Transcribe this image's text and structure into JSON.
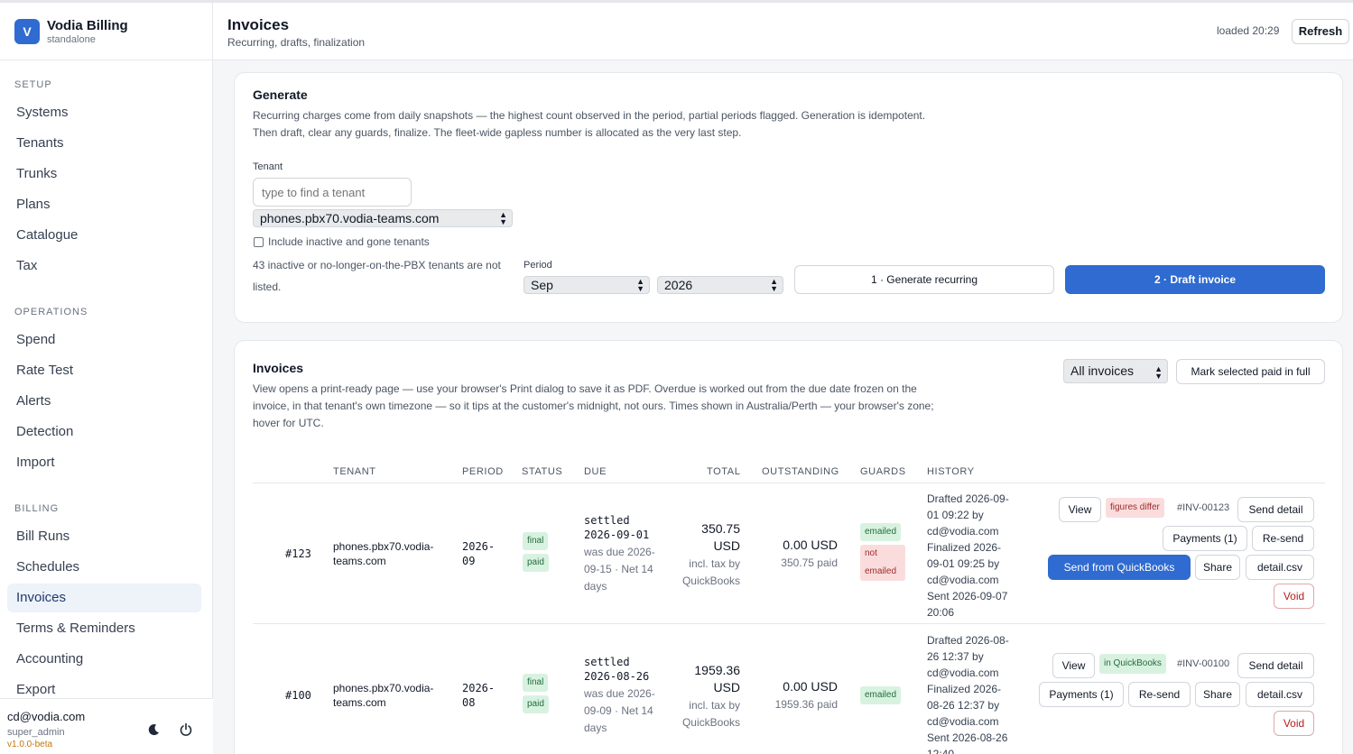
{
  "app": {
    "name": "Vodia Billing",
    "mode": "standalone",
    "logo_letter": "V"
  },
  "sidebar": {
    "sections": [
      {
        "label": "SETUP",
        "items": [
          "Systems",
          "Tenants",
          "Trunks",
          "Plans",
          "Catalogue",
          "Tax"
        ]
      },
      {
        "label": "OPERATIONS",
        "items": [
          "Spend",
          "Rate Test",
          "Alerts",
          "Detection",
          "Import"
        ]
      },
      {
        "label": "BILLING",
        "items": [
          "Bill Runs",
          "Schedules",
          "Invoices",
          "Terms & Reminders",
          "Accounting",
          "Export"
        ]
      }
    ],
    "active": "Invoices"
  },
  "user": {
    "email": "cd@vodia.com",
    "role": "super_admin",
    "version": "v1.0.0-beta"
  },
  "header": {
    "title": "Invoices",
    "subtitle": "Recurring, drafts, finalization",
    "loaded": "loaded 20:29",
    "refresh": "Refresh"
  },
  "generate": {
    "title": "Generate",
    "help": "Recurring charges come from daily snapshots — the highest count observed in the period, partial periods flagged. Generation is idempotent. Then draft, clear any guards, finalize. The fleet-wide gapless number is allocated as the very last step.",
    "tenant_label": "Tenant",
    "tenant_placeholder": "type to find a tenant",
    "tenant_selected": "phones.pbx70.vodia-teams.com",
    "include_inactive": "Include inactive and gone tenants",
    "inactive_note": "43 inactive or no-longer-on-the-PBX tenants are not listed.",
    "period_label": "Period",
    "month": "Sep",
    "year": "2026",
    "generate_btn": "1 · Generate recurring",
    "draft_btn": "2 · Draft invoice"
  },
  "invoices": {
    "title": "Invoices",
    "help": "View opens a print-ready page — use your browser's Print dialog to save it as PDF. Overdue is worked out from the due date frozen on the invoice, in that tenant's own timezone — so it tips at the customer's midnight, not ours. Times shown in Australia/Perth — your browser's zone; hover for UTC.",
    "filter": "All invoices",
    "mark_paid": "Mark selected paid in full",
    "columns": [
      "TENANT",
      "PERIOD",
      "STATUS",
      "DUE",
      "TOTAL",
      "OUTSTANDING",
      "GUARDS",
      "HISTORY"
    ],
    "actions": {
      "view": "View",
      "send_detail": "Send detail",
      "payments": "Payments (1)",
      "resend": "Re-send",
      "send_qb": "Send from QuickBooks",
      "share": "Share",
      "csv": "detail.csv",
      "void": "Void"
    },
    "rows": [
      {
        "id": "#123",
        "tenant": "phones.pbx70.vodia-teams.com",
        "period": "2026-09",
        "status": [
          "final",
          "paid"
        ],
        "due_line1": "settled",
        "due_line2": "2026-09-01",
        "due_note": "was due 2026-09-15 · Net 14 days",
        "total": "350.75 USD",
        "total_note": "incl. tax by QuickBooks",
        "outstanding": "0.00 USD",
        "outstanding_note": "350.75 paid",
        "guards": [
          "emailed",
          "not emailed"
        ],
        "history": "Drafted 2026-09-01 09:22 by cd@vodia.com Finalized 2026-09-01 09:25 by cd@vodia.com Sent 2026-09-07 20:06",
        "qb_tag": "figures differ",
        "inv_num": "#INV-00123"
      },
      {
        "id": "#100",
        "tenant": "phones.pbx70.vodia-teams.com",
        "period": "2026-08",
        "status": [
          "final",
          "paid"
        ],
        "due_line1": "settled",
        "due_line2": "2026-08-26",
        "due_note": "was due 2026-09-09 · Net 14 days",
        "total": "1959.36 USD",
        "total_note": "incl. tax by QuickBooks",
        "outstanding": "0.00 USD",
        "outstanding_note": "1959.36 paid",
        "guards": [
          "emailed"
        ],
        "history": "Drafted 2026-08-26 12:37 by cd@vodia.com Finalized 2026-08-26 12:37 by cd@vodia.com Sent 2026-08-26 12:40",
        "qb_tag": "in QuickBooks",
        "inv_num": "#INV-00100"
      }
    ]
  }
}
